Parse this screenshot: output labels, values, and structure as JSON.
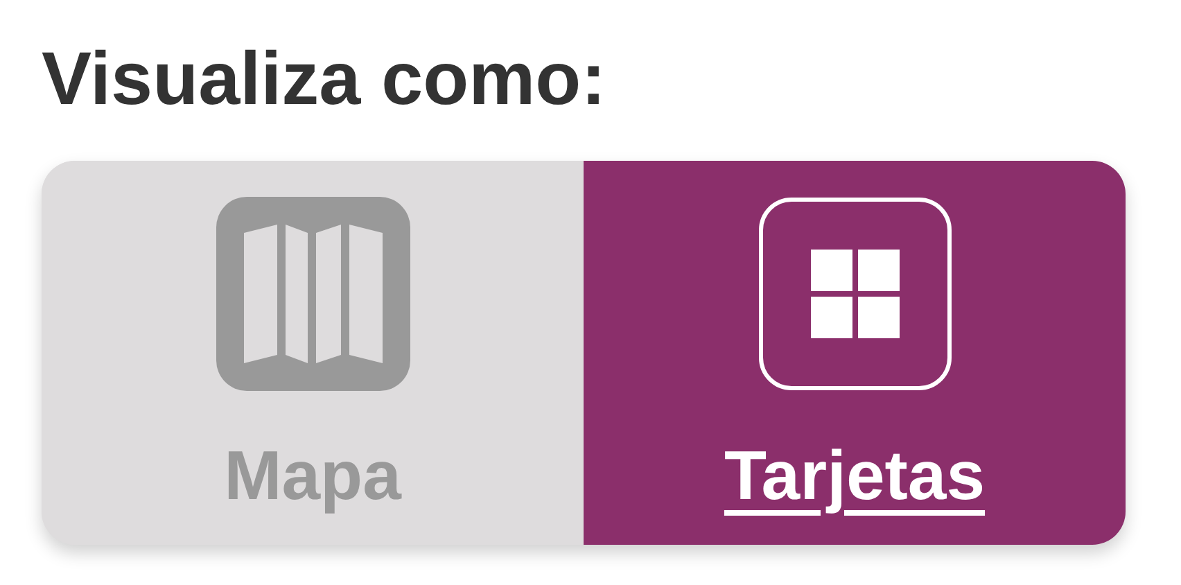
{
  "title": "Visualiza como:",
  "options": [
    {
      "kind": "map",
      "label": "Mapa",
      "selected": false
    },
    {
      "kind": "cards",
      "label": "Tarjetas",
      "selected": true
    }
  ]
}
